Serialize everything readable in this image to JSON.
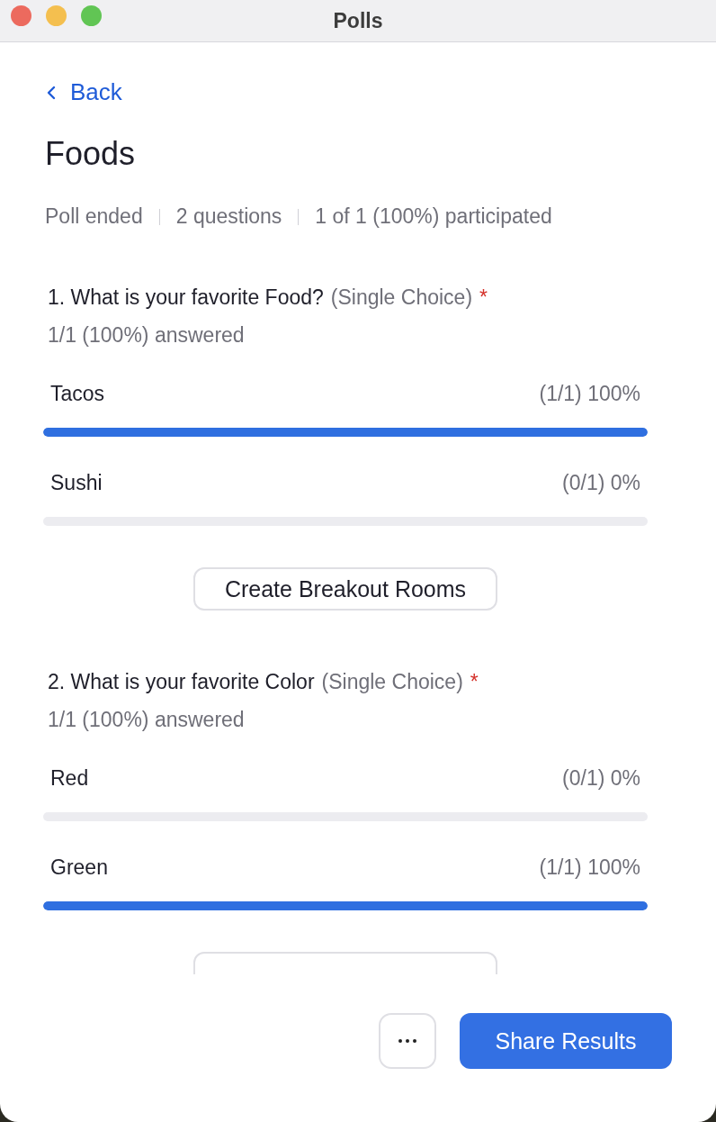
{
  "window": {
    "title": "Polls"
  },
  "back": {
    "label": "Back"
  },
  "poll": {
    "title": "Foods",
    "meta": [
      "Poll ended",
      "2 questions",
      "1 of 1 (100%) participated"
    ]
  },
  "questions": [
    {
      "text": "1. What is your favorite Food?",
      "type": "(Single Choice)",
      "required_mark": "*",
      "answered": "1/1 (100%) answered",
      "options": [
        {
          "label": "Tacos",
          "result": "(1/1) 100%",
          "level": 1
        },
        {
          "label": "Sushi",
          "result": "(0/1) 0%",
          "level": 0
        }
      ],
      "action": {
        "label": "Create Breakout Rooms"
      }
    },
    {
      "text": "2. What is your favorite Color",
      "type": "(Single Choice)",
      "required_mark": "*",
      "answered": "1/1 (100%) answered",
      "options": [
        {
          "label": "Red",
          "result": "(0/1) 0%",
          "level": 0
        },
        {
          "label": "Green",
          "result": "(1/1) 100%",
          "level": 1
        }
      ],
      "action_cut_off": true
    }
  ],
  "footer": {
    "more_button": true,
    "primary": {
      "label": "Share Results"
    }
  }
}
